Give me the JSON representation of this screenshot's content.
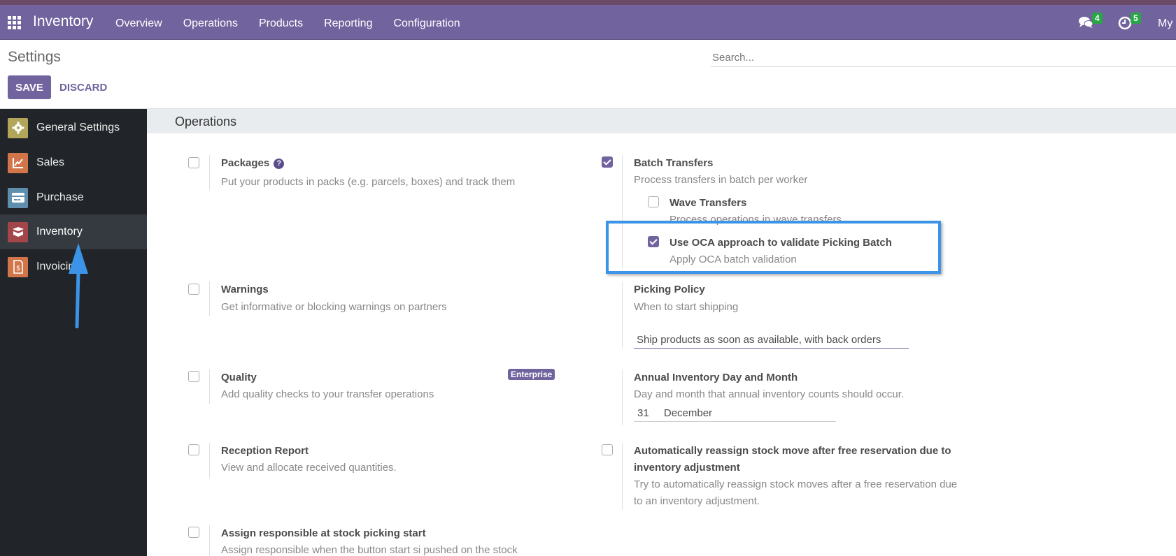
{
  "navbar": {
    "app_name": "Inventory",
    "menu": [
      "Overview",
      "Operations",
      "Products",
      "Reporting",
      "Configuration"
    ],
    "messages_count": "4",
    "activities_count": "5",
    "user_label": "My",
    "icons": {
      "apps": "apps-grid-icon",
      "messages": "chat-bubbles-icon",
      "activities": "clock-icon"
    }
  },
  "control_panel": {
    "title": "Settings",
    "save_label": "SAVE",
    "discard_label": "DISCARD",
    "search_placeholder": "Search..."
  },
  "sidebar": {
    "items": [
      {
        "label": "General Settings",
        "icon": "gear-icon",
        "color": "#b2a65a",
        "active": false
      },
      {
        "label": "Sales",
        "icon": "chart-trend-icon",
        "color": "#d2764a",
        "active": false
      },
      {
        "label": "Purchase",
        "icon": "credit-card-icon",
        "color": "#5f8fae",
        "active": false
      },
      {
        "label": "Inventory",
        "icon": "box-icon",
        "color": "#a3464a",
        "active": true
      },
      {
        "label": "Invoicing",
        "icon": "invoice-dollar-icon",
        "color": "#d2764a",
        "active": false
      }
    ]
  },
  "section": {
    "title": "Operations",
    "settings": {
      "packages": {
        "title": "Packages",
        "desc": "Put your products in packs (e.g. parcels, boxes) and track them",
        "checked": false
      },
      "batch_transfers": {
        "title": "Batch Transfers",
        "desc": "Process transfers in batch per worker",
        "checked": true
      },
      "wave_transfers": {
        "title": "Wave Transfers",
        "desc": "Process operations in wave transfers",
        "checked": false
      },
      "oca_batch": {
        "title": "Use OCA approach to validate Picking Batch",
        "desc": "Apply OCA batch validation",
        "checked": true
      },
      "warnings": {
        "title": "Warnings",
        "desc": "Get informative or blocking warnings on partners",
        "checked": false
      },
      "picking_policy": {
        "title": "Picking Policy",
        "desc": "When to start shipping",
        "value": "Ship products as soon as available, with back orders"
      },
      "quality": {
        "title": "Quality",
        "desc": "Add quality checks to your transfer operations",
        "badge": "Enterprise",
        "checked": false
      },
      "annual_inventory": {
        "title": "Annual Inventory Day and Month",
        "desc": "Day and month that annual inventory counts should occur.",
        "day": "31",
        "month": "December"
      },
      "reception_report": {
        "title": "Reception Report",
        "desc": "View and allocate received quantities.",
        "checked": false
      },
      "auto_reassign": {
        "title_line1": "Automatically reassign stock move after free reservation due to",
        "title_line2": "inventory adjustment",
        "desc_line1": "Try to automatically reassign stock moves after a free reservation due",
        "desc_line2": "to an inventory adjustment.",
        "checked": false
      },
      "assign_responsible": {
        "title": "Assign responsible at stock picking start",
        "desc": "Assign responsible when the button start si pushed on the stock",
        "checked": false
      }
    }
  },
  "colors": {
    "brand": "#71639e",
    "highlight": "#3b94e8",
    "badge": "#28a745"
  }
}
